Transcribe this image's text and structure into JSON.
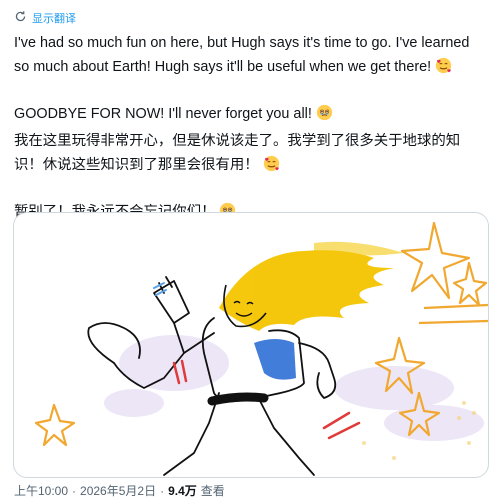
{
  "translate": {
    "label": "显示翻译"
  },
  "post": {
    "en_line1": "I've had so much fun on here, but Hugh says it's time to go. I've learned so much about Earth! Hugh says it'll be useful when we get there!",
    "en_line2": "GOODBYE FOR NOW! I'll never forget you all!",
    "zh_line1": "我在这里玩得非常开心，但是休说该走了。我学到了很多关于地球的知识！休说这些知识到了那里会很有用！",
    "zh_line2": "暂别了！我永远不会忘记你们！"
  },
  "meta": {
    "time": "上午10:00",
    "sep1": "·",
    "date": "2026年5月2日",
    "sep2": "·",
    "views": "9.4万",
    "views_label": "查看"
  },
  "colors": {
    "accent": "#1d9bf0",
    "hair": "#f2c200",
    "shirt": "#2f6fd6",
    "stars": "#f0a830"
  },
  "icons": {
    "translate": "translate-icon",
    "emoji_hearts": "smiling-face-with-hearts-emoji",
    "emoji_teary": "face-holding-back-tears-emoji"
  }
}
